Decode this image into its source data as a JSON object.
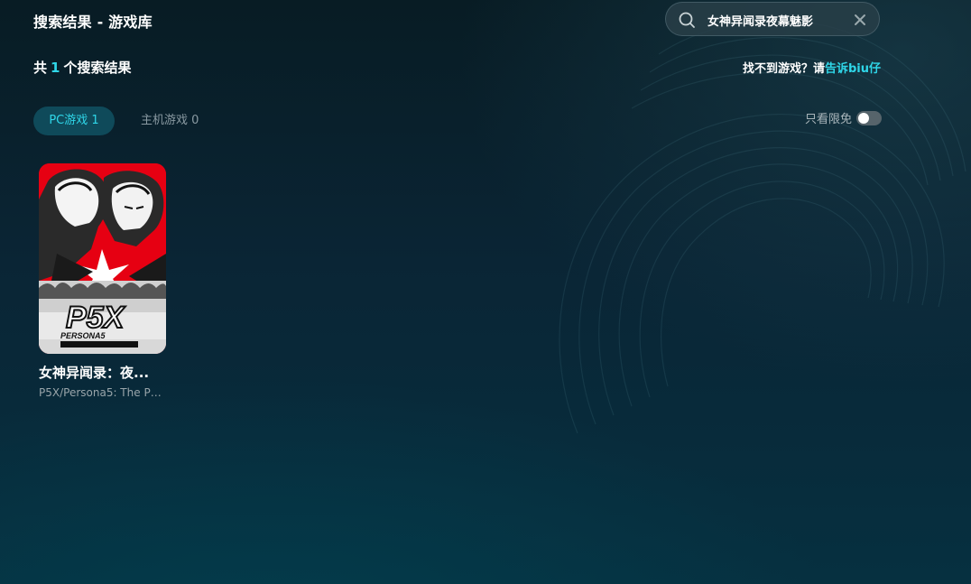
{
  "header": {
    "title": "搜索结果 - 游戏库"
  },
  "search": {
    "value": "女神异闻录夜幕魅影",
    "search_icon": "search-icon",
    "clear_icon": "close-icon"
  },
  "summary": {
    "prefix": "共",
    "count": "1",
    "suffix": "个搜索结果"
  },
  "help": {
    "text": "找不到游戏？请",
    "link": "告诉biu仔"
  },
  "tabs": [
    {
      "label": "PC游戏 1",
      "active": true
    },
    {
      "label": "主机游戏 0",
      "active": false
    }
  ],
  "filter": {
    "label": "只看限免",
    "enabled": false
  },
  "results": [
    {
      "name": "女神异闻录：夜...",
      "subtitle": "P5X/Persona5: The Ph...",
      "cover_logo": "P5X",
      "cover_caption": "PERSONA5"
    }
  ],
  "colors": {
    "accent": "#2fd6e8",
    "cover_red": "#e60012"
  }
}
